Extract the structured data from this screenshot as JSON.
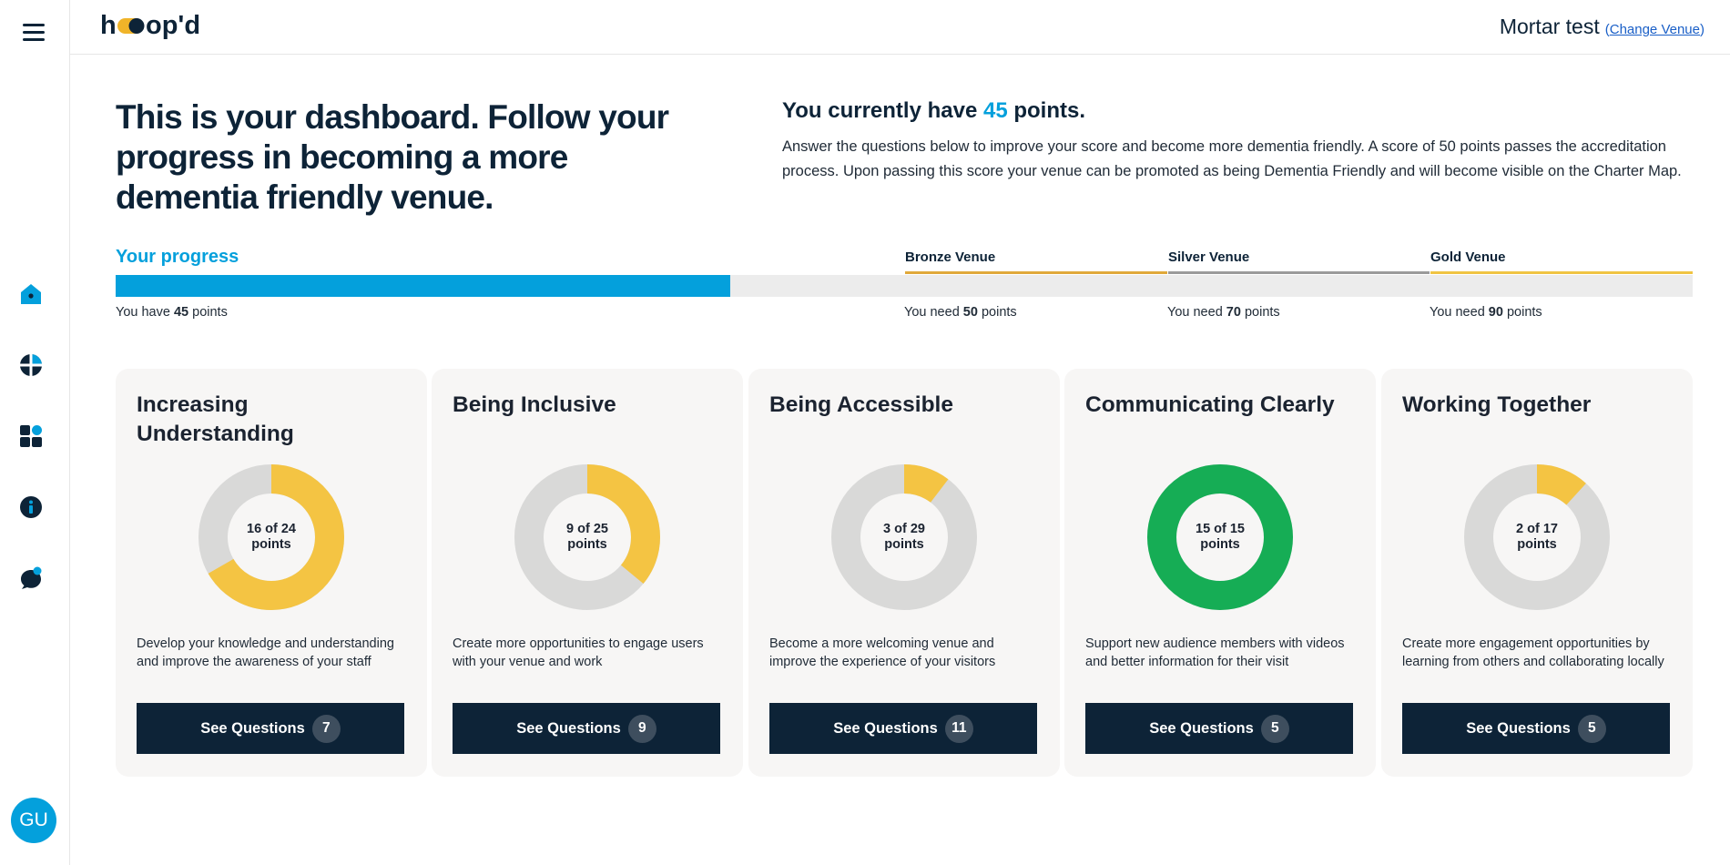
{
  "app": {
    "logo_text": "hoop'd",
    "venue_name": "Mortar test",
    "change_venue_label": "Change Venue",
    "avatar_initials": "GU"
  },
  "sidebar": {
    "items": [
      {
        "name": "home",
        "icon": "home-icon"
      },
      {
        "name": "grid",
        "icon": "quadrant-icon"
      },
      {
        "name": "apps",
        "icon": "apps-icon"
      },
      {
        "name": "info",
        "icon": "info-icon"
      },
      {
        "name": "chat",
        "icon": "chat-icon"
      }
    ]
  },
  "intro": {
    "headline": "This is your dashboard. Follow your progress in becoming a more dementia friendly venue.",
    "points_prefix": "You currently have ",
    "points_value": "45",
    "points_suffix": " points.",
    "description": "Answer the questions below to improve your score and become more dementia friendly. A score of 50 points passes the accreditation process. Upon passing this score your venue can be promoted as being Dementia Friendly and will become visible on the Charter Map."
  },
  "progress": {
    "label": "Your progress",
    "have_prefix": "You have ",
    "have_points": "45",
    "points_word": " points",
    "value": 45,
    "max": 90,
    "need_prefix": "You need ",
    "tiers": [
      {
        "label": "Bronze Venue",
        "points": "50",
        "color": "#e0a93a"
      },
      {
        "label": "Silver Venue",
        "points": "70",
        "color": "#9a9a9a"
      },
      {
        "label": "Gold Venue",
        "points": "90",
        "color": "#f0c443"
      }
    ]
  },
  "colors": {
    "accent": "#04a0dc",
    "navy": "#0d2337",
    "donut_track": "#d9d9d8",
    "donut_partial": "#f4c443",
    "donut_complete": "#16ad55"
  },
  "categories": [
    {
      "title": "Increasing Understanding",
      "score": 16,
      "total": 24,
      "score_line": "16 of 24",
      "points_word": "points",
      "description": "Develop your knowledge and understanding and improve the awareness of your staff",
      "button_label": "See Questions",
      "question_count": "7"
    },
    {
      "title": "Being Inclusive",
      "score": 9,
      "total": 25,
      "score_line": "9 of 25",
      "points_word": "points",
      "description": "Create more opportunities to engage users with your venue and work",
      "button_label": "See Questions",
      "question_count": "9"
    },
    {
      "title": "Being Accessible",
      "score": 3,
      "total": 29,
      "score_line": "3 of 29",
      "points_word": "points",
      "description": "Become a more welcoming venue and improve the experience of your visitors",
      "button_label": "See Questions",
      "question_count": "11"
    },
    {
      "title": "Communicating Clearly",
      "score": 15,
      "total": 15,
      "score_line": "15 of 15",
      "points_word": "points",
      "description": "Support new audience members with videos and better information for their visit",
      "button_label": "See Questions",
      "question_count": "5"
    },
    {
      "title": "Working Together",
      "score": 2,
      "total": 17,
      "score_line": "2 of 17",
      "points_word": "points",
      "description": "Create more engagement opportunities by learning from others and collaborating locally",
      "button_label": "See Questions",
      "question_count": "5"
    }
  ]
}
